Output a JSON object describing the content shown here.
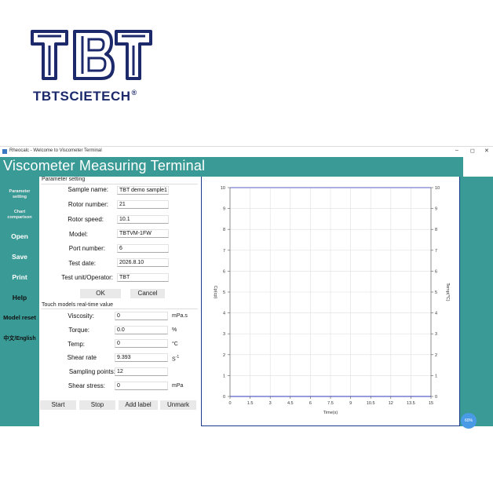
{
  "brand": {
    "name": "TBTSCIETECH",
    "reg_mark": "®",
    "logo_letters": "TBT"
  },
  "window": {
    "title": "Rheocalc - Welcome to Viscometer Terminal",
    "controls": {
      "minimize": "–",
      "maximize": "◻",
      "close": "✕"
    }
  },
  "header": {
    "title": "Viscometer Measuring Terminal"
  },
  "sidebar": {
    "items": [
      {
        "label_line1": "Parameter",
        "label_line2": "setting"
      },
      {
        "label_line1": "Chart",
        "label_line2": "comparison"
      },
      {
        "label": "Open"
      },
      {
        "label": "Save"
      },
      {
        "label": "Print"
      },
      {
        "label": "Help"
      },
      {
        "label": "Model reset"
      },
      {
        "label": "中文/English"
      }
    ]
  },
  "params": {
    "group_title": "Parameter setting",
    "sample_name": {
      "label": "Sample name:",
      "value": "TBT demo sample1"
    },
    "rotor_number": {
      "label": "Rotor number:",
      "value": "21"
    },
    "rotor_speed": {
      "label": "Rotor speed:",
      "value": "10.1"
    },
    "model": {
      "label": "Model:",
      "value": "TBTVM-1FW"
    },
    "port_number": {
      "label": "Port number:",
      "value": "6"
    },
    "test_date": {
      "label": "Test date:",
      "value": "2026.8.10"
    },
    "operator": {
      "label": "Test unit/Operator:",
      "value": "TBT"
    },
    "ok_label": "OK",
    "cancel_label": "Cancel"
  },
  "realtime": {
    "group_title": "Touch models real-time value",
    "viscosity": {
      "label": "Viscosity:",
      "value": "0",
      "unit": "mPa.s"
    },
    "torque": {
      "label": "Torque:",
      "value": "0.0",
      "unit": "%"
    },
    "temp": {
      "label": "Temp:",
      "value": "0",
      "unit": "°C"
    },
    "shear_rate": {
      "label": "Shear rate",
      "value": "9.393",
      "unit": "S",
      "unit_sup": "-1"
    },
    "sampling_points": {
      "label": "Sampling points:",
      "value": "12"
    },
    "shear_stress": {
      "label": "Shear stress:",
      "value": "0",
      "unit": "mPa"
    }
  },
  "buttons": {
    "start": "Start",
    "stop": "Stop",
    "add_label": "Add label",
    "unmark": "Unmark"
  },
  "float_button": {
    "label": "60%"
  },
  "colors": {
    "teal": "#3a9a96",
    "navy": "#1e3a8a",
    "plot_line": "#5b5fc7"
  },
  "chart_data": {
    "type": "line",
    "xlabel": "Time(s)",
    "ylabel_left": "Cp(cp)",
    "ylabel_right": "Temp(℃)",
    "xlim": [
      0,
      15
    ],
    "ylim": [
      0,
      10
    ],
    "x_ticks": [
      "0",
      "1.5",
      "3",
      "4.5",
      "6",
      "7.5",
      "9",
      "10.5",
      "12",
      "13.5",
      "15"
    ],
    "y_ticks": [
      "0",
      "1",
      "2",
      "3",
      "4",
      "5",
      "6",
      "7",
      "8",
      "9",
      "10"
    ],
    "grid": true,
    "series": []
  }
}
